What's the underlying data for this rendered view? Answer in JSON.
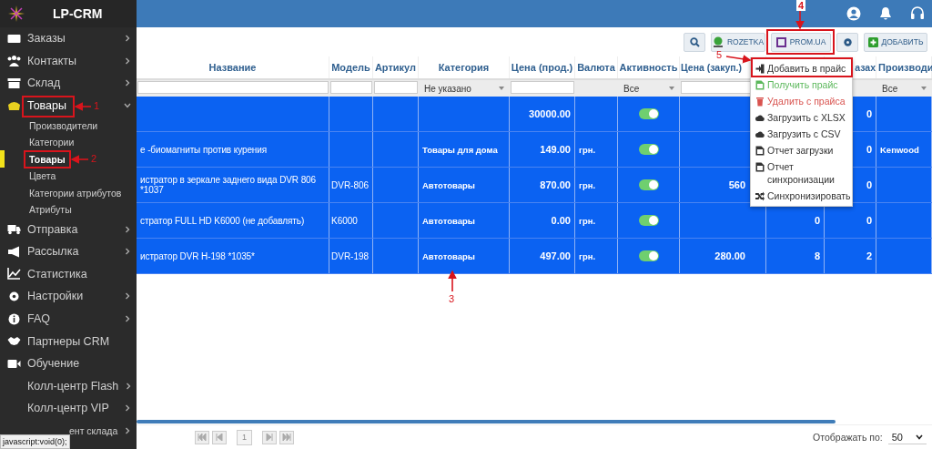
{
  "brand": {
    "name": "LP-CRM"
  },
  "sidebar": {
    "items": [
      {
        "label": "Заказы",
        "kind": "group",
        "expanded": false
      },
      {
        "label": "Контакты",
        "kind": "group",
        "expanded": false
      },
      {
        "label": "Склад",
        "kind": "group",
        "expanded": false
      },
      {
        "label": "Товары",
        "kind": "group",
        "expanded": true,
        "children": [
          {
            "label": "Производители",
            "selected": false
          },
          {
            "label": "Категории",
            "selected": false
          },
          {
            "label": "Товары",
            "selected": true
          },
          {
            "label": "Цвета",
            "selected": false
          },
          {
            "label": "Категории атрибутов",
            "selected": false
          },
          {
            "label": "Атрибуты",
            "selected": false
          }
        ]
      },
      {
        "label": "Отправка",
        "kind": "group",
        "expanded": false
      },
      {
        "label": "Рассылка",
        "kind": "group",
        "expanded": false
      },
      {
        "label": "Статистика",
        "kind": "link"
      },
      {
        "label": "Настройки",
        "kind": "group",
        "expanded": false
      },
      {
        "label": "FAQ",
        "kind": "group",
        "expanded": false
      },
      {
        "label": "Партнеры CRM",
        "kind": "link"
      },
      {
        "label": "Обучение",
        "kind": "link"
      },
      {
        "label": "Колл-центр Flash",
        "kind": "group",
        "expanded": false
      },
      {
        "label": "Колл-центр VIP",
        "kind": "group",
        "expanded": false
      },
      {
        "label": "ент склада",
        "kind": "group",
        "expanded": false
      }
    ]
  },
  "status_bar": {
    "text": "javascript:void(0);"
  },
  "toolbar": {
    "buttons": [
      {
        "kind": "search"
      },
      {
        "kind": "rozetka",
        "label": "ROZETKA"
      },
      {
        "kind": "prom",
        "label": "PROM.UA"
      },
      {
        "kind": "settings"
      },
      {
        "kind": "add",
        "label": "ДОБАВИТЬ"
      }
    ]
  },
  "table": {
    "columns": [
      {
        "label": "Название"
      },
      {
        "label": "Модель"
      },
      {
        "label": "Артикул"
      },
      {
        "label": "Категория",
        "filter_value": "Не указано"
      },
      {
        "label": "Цена (прод.)"
      },
      {
        "label": "Валюта"
      },
      {
        "label": "Активность",
        "filter_value": "Все"
      },
      {
        "label": "Цена (закуп.)"
      },
      {},
      {
        "label": "азах"
      },
      {
        "label": "Производи",
        "filter_value": "Все"
      }
    ],
    "rows": [
      {
        "selected": true,
        "active": true,
        "price": "30000.00",
        "column_10": "0"
      },
      {
        "selected": true,
        "active": true,
        "name": "е -биомагниты против курения",
        "category": "Товары для дома",
        "price": "149.00",
        "currency": "грн.",
        "column_10": "0",
        "manufacturer": "Kenwood"
      },
      {
        "selected": true,
        "active": true,
        "name": "истратор в зеркале заднего вида DVR 806 *1037",
        "model": "DVR-806",
        "category": "Автотовары",
        "price": "870.00",
        "currency": "грн.",
        "purchase_price": "560",
        "column_10": "0"
      },
      {
        "selected": true,
        "active": true,
        "name": "стратор FULL HD K6000 (не добавлять)",
        "model": "K6000",
        "category": "Автотовары",
        "price": "0.00",
        "currency": "грн.",
        "column_9": "0",
        "column_10": "0"
      },
      {
        "selected": true,
        "active": true,
        "name": "истратор DVR H-198 *1035*",
        "model": "DVR-198",
        "category": "Автотовары",
        "price": "497.00",
        "currency": "грн.",
        "purchase_price": "280.00",
        "column_9": "8",
        "column_10": "2"
      }
    ]
  },
  "dropdown": {
    "items": [
      {
        "kind": "add",
        "label": "Добавить в прайс",
        "color": "#333333"
      },
      {
        "kind": "excel",
        "label": "Получить прайс",
        "color": "#5cb85c"
      },
      {
        "kind": "delete",
        "label": "Удалить с прайса",
        "color": "#d9534f"
      },
      {
        "kind": "upload",
        "label": "Загрузить с XLSX",
        "color": "#333333"
      },
      {
        "kind": "upload",
        "label": "Загрузить с CSV",
        "color": "#333333"
      },
      {
        "kind": "report",
        "label": "Отчет загрузки",
        "color": "#333333"
      },
      {
        "kind": "report",
        "label": "Отчет синхронизации",
        "color": "#333333"
      },
      {
        "kind": "sync",
        "label": "Синхронизировать",
        "color": "#333333"
      }
    ]
  },
  "pagination": {
    "page": "1",
    "page_size_label": "Отображать по:",
    "page_size": "50"
  },
  "annotations": [
    {
      "label": "1"
    },
    {
      "label": "2"
    },
    {
      "label": "3"
    },
    {
      "label": "4"
    },
    {
      "label": "5"
    }
  ]
}
